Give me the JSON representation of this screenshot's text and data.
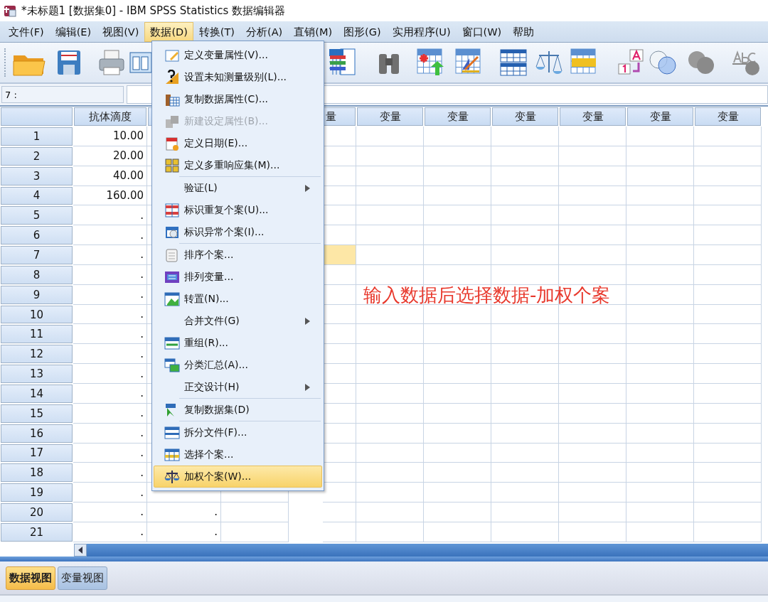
{
  "window": {
    "title": "*未标题1 [数据集0] - IBM SPSS Statistics 数据编辑器"
  },
  "menu_bar": [
    {
      "label": "文件(F)",
      "selected": false
    },
    {
      "label": "编辑(E)",
      "selected": false
    },
    {
      "label": "视图(V)",
      "selected": false
    },
    {
      "label": "数据(D)",
      "selected": true
    },
    {
      "label": "转换(T)",
      "selected": false
    },
    {
      "label": "分析(A)",
      "selected": false
    },
    {
      "label": "直销(M)",
      "selected": false
    },
    {
      "label": "图形(G)",
      "selected": false
    },
    {
      "label": "实用程序(U)",
      "selected": false
    },
    {
      "label": "窗口(W)",
      "selected": false
    },
    {
      "label": "帮助",
      "selected": false
    }
  ],
  "cell_editor": {
    "cell_ref": "7 :"
  },
  "grid": {
    "columns": [
      {
        "header": "抗体滴度"
      },
      {},
      {},
      {
        "header": "量"
      },
      {
        "header": "变量"
      },
      {
        "header": "变量"
      },
      {
        "header": "变量"
      },
      {
        "header": "变量"
      },
      {
        "header": "变量"
      },
      {
        "header": "变量"
      }
    ],
    "rows": [
      {
        "number": "1",
        "cells": [
          {
            "text": "10.00",
            "selected": false
          }
        ]
      },
      {
        "number": "2",
        "cells": [
          {
            "text": "20.00",
            "selected": false
          }
        ]
      },
      {
        "number": "3",
        "cells": [
          {
            "text": "40.00",
            "selected": false
          }
        ]
      },
      {
        "number": "4",
        "cells": [
          {
            "text": "160.00",
            "selected": false
          }
        ]
      },
      {
        "number": "5",
        "cells": [
          {
            "text": ".",
            "selected": false
          }
        ]
      },
      {
        "number": "6",
        "cells": [
          {
            "text": ".",
            "selected": false
          }
        ]
      },
      {
        "number": "7",
        "cells": [
          {
            "text": ".",
            "selected": false
          },
          null,
          null,
          {
            "selected": true
          }
        ]
      },
      {
        "number": "8",
        "cells": [
          {
            "text": ".",
            "selected": false
          }
        ]
      },
      {
        "number": "9",
        "cells": [
          {
            "text": ".",
            "selected": false
          }
        ]
      },
      {
        "number": "10",
        "cells": [
          {
            "text": ".",
            "selected": false
          }
        ]
      },
      {
        "number": "11",
        "cells": [
          {
            "text": ".",
            "selected": false
          }
        ]
      },
      {
        "number": "12",
        "cells": [
          {
            "text": ".",
            "selected": false
          }
        ]
      },
      {
        "number": "13",
        "cells": [
          {
            "text": ".",
            "selected": false
          }
        ]
      },
      {
        "number": "14",
        "cells": [
          {
            "text": ".",
            "selected": false
          }
        ]
      },
      {
        "number": "15",
        "cells": [
          {
            "text": ".",
            "selected": false
          }
        ]
      },
      {
        "number": "16",
        "cells": [
          {
            "text": ".",
            "selected": false
          }
        ]
      },
      {
        "number": "17",
        "cells": [
          {
            "text": ".",
            "selected": false
          }
        ]
      },
      {
        "number": "18",
        "cells": [
          {
            "text": ".",
            "selected": false
          }
        ]
      },
      {
        "number": "19",
        "cells": [
          {
            "text": ".",
            "selected": false
          }
        ]
      },
      {
        "number": "20",
        "cells": [
          {
            "text": ".",
            "selected": false
          },
          {
            "text": ".",
            "selected": false
          }
        ]
      },
      {
        "number": "21",
        "cells": [
          {
            "text": ".",
            "selected": false
          },
          {
            "text": ".",
            "selected": false
          }
        ]
      }
    ]
  },
  "annotation": {
    "text": "输入数据后选择数据-加权个案"
  },
  "data_menu": {
    "items": [
      {
        "kind": "command",
        "label": "定义变量属性(V)...",
        "disabled": false,
        "selected": false
      },
      {
        "kind": "command",
        "label": "设置未知测量级别(L)...",
        "disabled": false,
        "selected": false
      },
      {
        "kind": "command",
        "label": "复制数据属性(C)...",
        "disabled": false,
        "selected": false
      },
      {
        "kind": "command",
        "label": "新建设定属性(B)...",
        "disabled": true,
        "selected": false
      },
      {
        "kind": "command",
        "label": "定义日期(E)...",
        "disabled": false,
        "selected": false
      },
      {
        "kind": "command",
        "label": "定义多重响应集(M)...",
        "disabled": false,
        "selected": false
      },
      {
        "kind": "separator"
      },
      {
        "kind": "submenu",
        "label": "验证(L)",
        "disabled": false,
        "selected": false
      },
      {
        "kind": "command",
        "label": "标识重复个案(U)...",
        "disabled": false,
        "selected": false
      },
      {
        "kind": "command",
        "label": "标识异常个案(I)...",
        "disabled": false,
        "selected": false
      },
      {
        "kind": "separator"
      },
      {
        "kind": "command",
        "label": "排序个案...",
        "disabled": false,
        "selected": false
      },
      {
        "kind": "command",
        "label": "排列变量...",
        "disabled": false,
        "selected": false
      },
      {
        "kind": "command",
        "label": "转置(N)...",
        "disabled": false,
        "selected": false
      },
      {
        "kind": "submenu",
        "label": "合并文件(G)",
        "disabled": false,
        "selected": false
      },
      {
        "kind": "command",
        "label": "重组(R)...",
        "disabled": false,
        "selected": false
      },
      {
        "kind": "command",
        "label": "分类汇总(A)...",
        "disabled": false,
        "selected": false
      },
      {
        "kind": "submenu",
        "label": "正交设计(H)",
        "disabled": false,
        "selected": false
      },
      {
        "kind": "separator"
      },
      {
        "kind": "command",
        "label": "复制数据集(D)",
        "disabled": false,
        "selected": false
      },
      {
        "kind": "separator"
      },
      {
        "kind": "command",
        "label": "拆分文件(F)...",
        "disabled": false,
        "selected": false
      },
      {
        "kind": "command",
        "label": "选择个案...",
        "disabled": false,
        "selected": false
      },
      {
        "kind": "command",
        "label": "加权个案(W)...",
        "disabled": false,
        "selected": true
      }
    ]
  },
  "view_tabs": [
    {
      "label": "数据视图",
      "selected": true
    },
    {
      "label": "变量视图",
      "selected": false
    }
  ]
}
